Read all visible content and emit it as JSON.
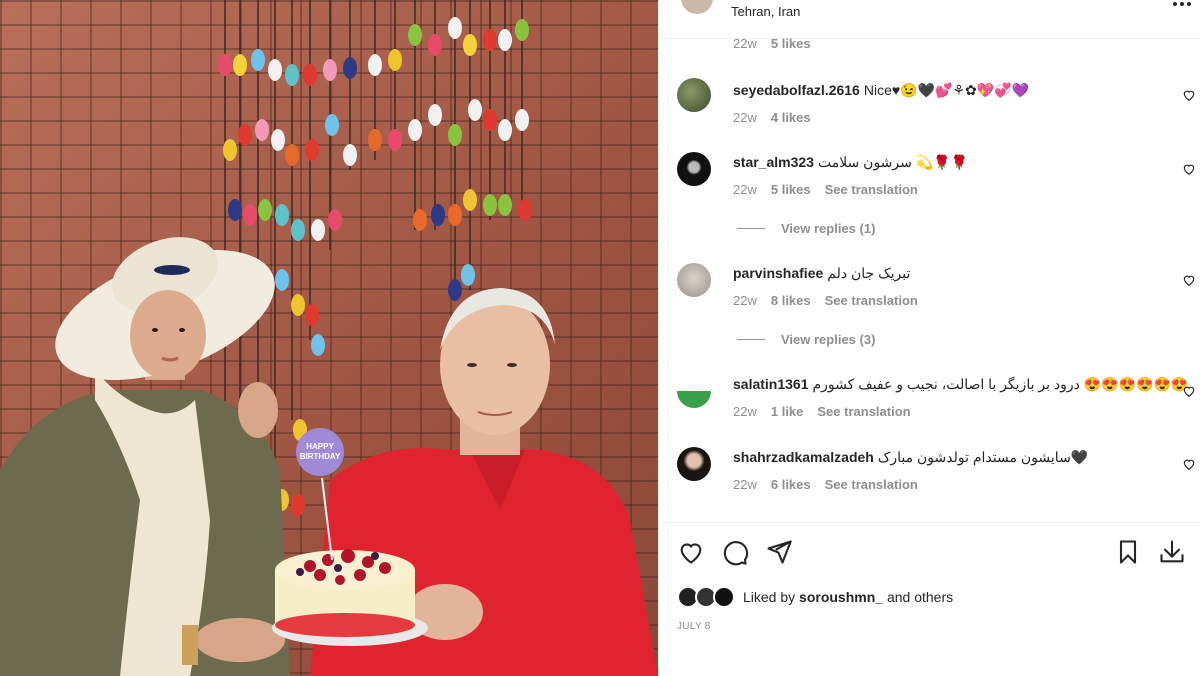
{
  "post": {
    "location": "Tehran, Iran",
    "date": "JULY 8"
  },
  "comments": [
    {
      "meta_time": "22w",
      "meta_likes": "5 likes"
    },
    {
      "username": "seyedabolfazl.2616",
      "text": "Nice♥😉🖤💕⚘✿💖💞💜",
      "time": "22w",
      "likes": "4 likes"
    },
    {
      "username": "star_alm323",
      "text": "سرشون سلامت 💫🌹🌹",
      "time": "22w",
      "likes": "5 likes",
      "translate": "See translation",
      "replies": "View replies (1)"
    },
    {
      "username": "parvinshafiee",
      "text": "تبریک جان دلم",
      "time": "22w",
      "likes": "8 likes",
      "translate": "See translation",
      "replies": "View replies (3)"
    },
    {
      "username": "salatin1361",
      "text": "درود بر بازیگر با اصالت، نجیب و عفیف کشورم 😍😍😍😍😍😍",
      "time": "22w",
      "likes": "1 like",
      "translate": "See translation"
    },
    {
      "username": "shahrzadkamalzadeh",
      "text": "سایشون مستدام تولدشون مبارک🖤",
      "time": "22w",
      "likes": "6 likes",
      "translate": "See translation"
    }
  ],
  "liked_by": {
    "prefix": "Liked by",
    "user": "soroushmn_",
    "suffix": "and others"
  },
  "photo": {
    "topper_line1": "HAPPY",
    "topper_line2": "BIRTHDAY"
  },
  "colors": {
    "muted": "#8e8e8e",
    "text": "#262626",
    "shirt": "#e0242f"
  },
  "icons": [
    "heart-icon",
    "comment-icon",
    "share-icon",
    "bookmark-icon",
    "download-icon",
    "more-icon"
  ]
}
